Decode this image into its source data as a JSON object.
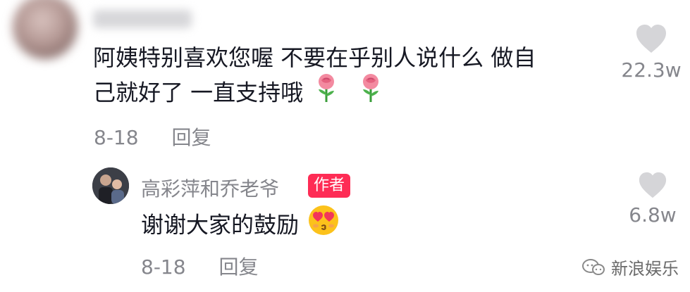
{
  "comment": {
    "text_line1": "阿姨特别喜欢您喔 不要在乎别人说什么 做自",
    "text_line2": "己就好了 一直支持哦",
    "emojis": [
      "rose",
      "rose"
    ],
    "date": "8-18",
    "reply_label": "回复",
    "like_count": "22.3w"
  },
  "reply": {
    "author_name": "高彩萍和乔老爷",
    "author_badge": "作者",
    "text": "谢谢大家的鼓励",
    "emoji": "heart-eyes",
    "date": "8-18",
    "reply_label": "回复",
    "like_count": "6.8w"
  },
  "watermark": {
    "text": "新浪娱乐",
    "icon": "weibo-chat-icon"
  },
  "colors": {
    "text_primary": "#161823",
    "text_secondary": "#85868c",
    "heart_gray": "#d5d5d8",
    "badge_red": "#fe2c55"
  }
}
